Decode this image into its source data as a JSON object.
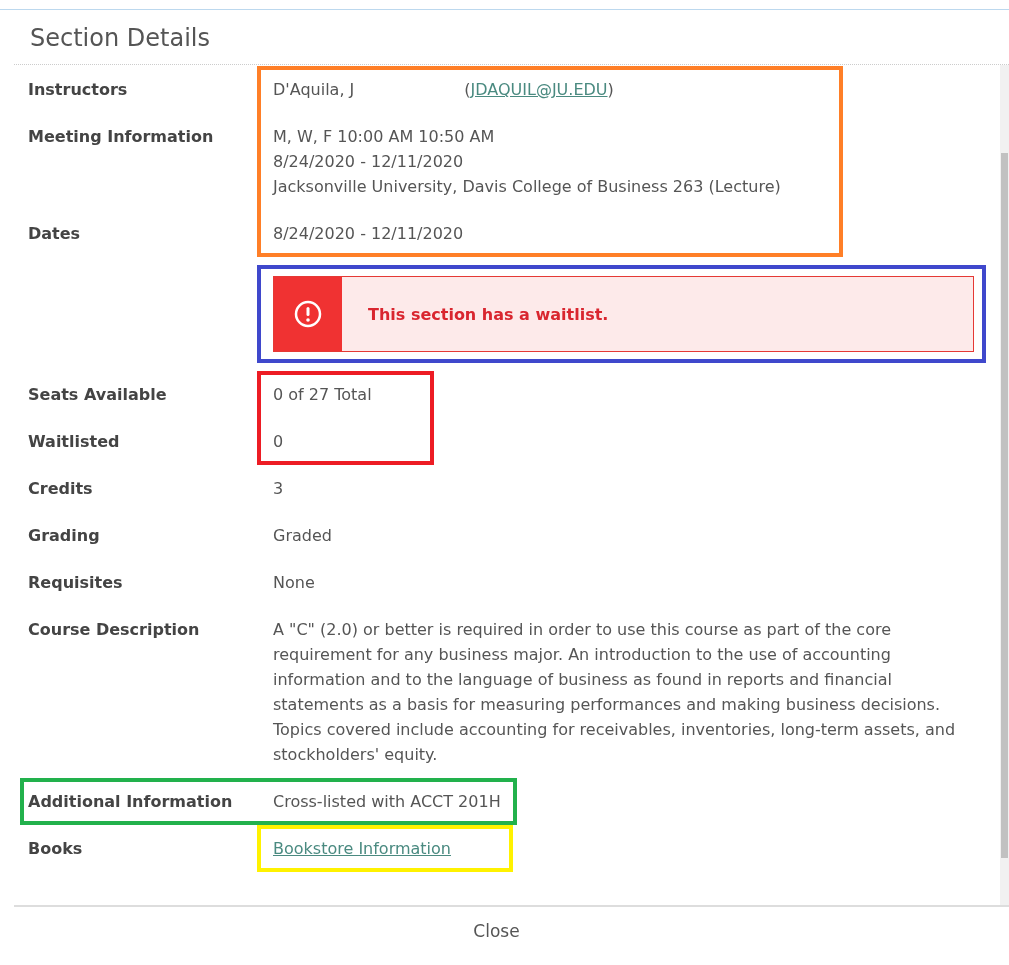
{
  "dialog": {
    "title": "Section Details",
    "close_button": "Close"
  },
  "groups": [
    {
      "highlight": {
        "color": "#ff7f27",
        "kind": "values"
      },
      "rows": [
        {
          "kind": "instructor",
          "label": "Instructors",
          "name": "D'Aquila, J",
          "open": "(",
          "email": "JDAQUIL@JU.EDU",
          "close": ")"
        },
        {
          "kind": "text",
          "label": "Meeting Information",
          "lines": [
            "M, W, F 10:00 AM 10:50 AM",
            "8/24/2020 - 12/11/2020",
            "Jacksonville University, Davis College of Business 263 (Lecture)"
          ]
        },
        {
          "kind": "text",
          "label": "Dates",
          "lines": [
            "8/24/2020 - 12/11/2020"
          ]
        }
      ]
    },
    {
      "highlight": {
        "color": "#3f48cc",
        "kind": "full"
      },
      "rows": [
        {
          "kind": "alert",
          "text": "This section has a waitlist."
        }
      ]
    },
    {
      "highlight": {
        "color": "#ed1c24",
        "kind": "values"
      },
      "rows": [
        {
          "kind": "text",
          "label": "Seats Available",
          "lines": [
            "0 of 27 Total"
          ]
        },
        {
          "kind": "text",
          "label": "Waitlisted",
          "lines": [
            "0"
          ]
        }
      ]
    },
    {
      "rows": [
        {
          "kind": "text",
          "label": "Credits",
          "lines": [
            "3"
          ]
        },
        {
          "kind": "text",
          "label": "Grading",
          "lines": [
            "Graded"
          ]
        },
        {
          "kind": "text",
          "label": "Requisites",
          "lines": [
            "None"
          ]
        },
        {
          "kind": "paragraph",
          "label": "Course Description",
          "text": "A \"C\" (2.0) or better is required in order to use this course as part of the core requirement for any business major. An introduction to the use of accounting information and to the language of business as found in reports and financial statements as a basis for measuring performances and making business decisions. Topics covered include accounting for receivables, inventories, long-term assets, and stockholders' equity."
        }
      ]
    },
    {
      "highlight": {
        "color": "#22b14c",
        "kind": "row"
      },
      "rows": [
        {
          "kind": "text",
          "label": "Additional Information",
          "lines": [
            "Cross-listed with ACCT 201H"
          ]
        }
      ]
    },
    {
      "highlight": {
        "color": "#fff200",
        "kind": "values"
      },
      "rows": [
        {
          "kind": "link",
          "label": "Books",
          "text": "Bookstore Information"
        }
      ]
    }
  ]
}
